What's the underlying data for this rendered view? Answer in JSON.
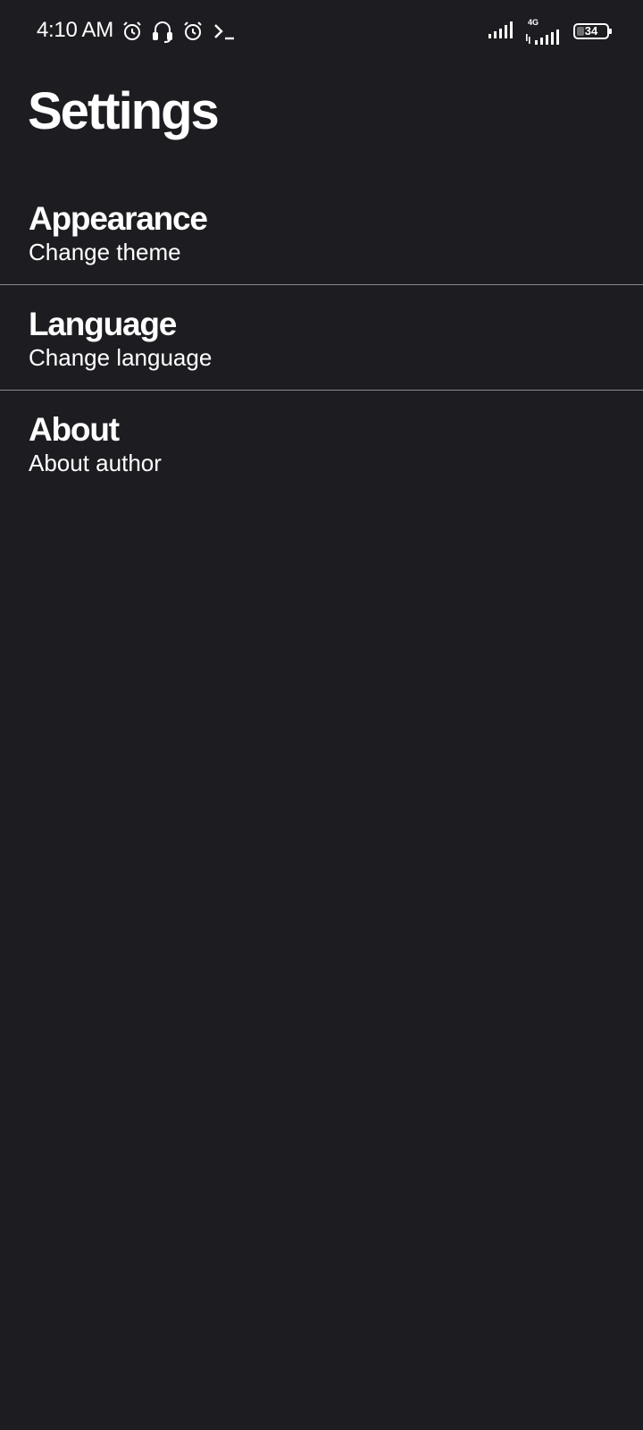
{
  "status_bar": {
    "time": "4:10 AM",
    "left_icons": [
      "alarm-icon",
      "headset-icon",
      "alarm-icon",
      "terminal-icon"
    ],
    "network_label": "4G",
    "battery_level": "34",
    "battery_fraction": 0.34
  },
  "page": {
    "title": "Settings"
  },
  "settings": {
    "items": [
      {
        "title": "Appearance",
        "subtitle": "Change theme"
      },
      {
        "title": "Language",
        "subtitle": "Change language"
      },
      {
        "title": "About",
        "subtitle": "About author"
      }
    ]
  },
  "colors": {
    "background": "#1d1c21",
    "text": "#ffffff",
    "divider": "#8c8b90"
  }
}
